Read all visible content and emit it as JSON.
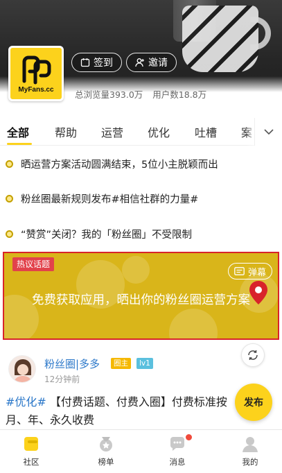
{
  "header": {
    "logo_text": "MyFans.cc",
    "checkin_label": "签到",
    "invite_label": "邀请",
    "views_text": "总浏览量393.0万",
    "users_text": "用户数18.8万"
  },
  "tabs": [
    {
      "label": "全部",
      "active": true
    },
    {
      "label": "帮助",
      "active": false
    },
    {
      "label": "运营",
      "active": false
    },
    {
      "label": "优化",
      "active": false
    },
    {
      "label": "吐槽",
      "active": false
    },
    {
      "label": "案",
      "active": false
    }
  ],
  "notices": [
    {
      "text": "晒运营方案活动圆满结束，5位小主脱颖而出"
    },
    {
      "text": "粉丝圈最新规则发布#相信社群的力量#"
    },
    {
      "text": "“赞赏”关闭？我的「粉丝圈」不受限制"
    }
  ],
  "promo": {
    "tag": "热议话题",
    "danmu_label": "弹幕",
    "text": "免费获取应用，晒出你的粉丝圈运营方案"
  },
  "post": {
    "user": "粉丝圈|多多",
    "badge_owner": "圈主",
    "badge_level": "lv1",
    "time": "12分钟前",
    "hashtag": "#优化#",
    "body": " 【付费话题、付费入圈】付费标准按月、年、永久收费"
  },
  "publish_label": "发布",
  "bottom_nav": [
    {
      "label": "社区",
      "icon": "community-icon",
      "active": true
    },
    {
      "label": "榜单",
      "icon": "ranking-icon",
      "active": false
    },
    {
      "label": "消息",
      "icon": "message-icon",
      "active": false
    },
    {
      "label": "我的",
      "icon": "profile-icon",
      "active": false
    }
  ],
  "colors": {
    "accent": "#fcd21c",
    "link": "#2c78c9",
    "promo_bg": "#d9b51a",
    "promo_border": "#d8232a",
    "badge_owner": "#f5b800",
    "badge_level": "#5bc0de"
  }
}
